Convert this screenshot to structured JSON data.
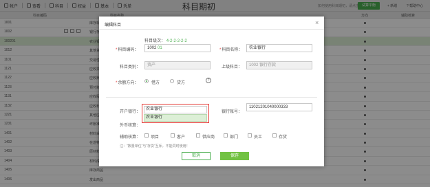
{
  "toolbar": {
    "items": [
      "帐户",
      "查看",
      "科目",
      "权益",
      "基本",
      "凭单"
    ],
    "title": "科目期初",
    "right_text": "如何使用科目期初，请点击查看帮助",
    "green_button": "试算平衡",
    "link_add": "+ 新增",
    "link_help": "? 帮助中心"
  },
  "table": {
    "headers": [
      "科目编码",
      "科目名称",
      "方向",
      "辅助核算"
    ],
    "rows": [
      {
        "code": "1001",
        "name": "库存现金"
      },
      {
        "code": "1002",
        "name": "银行存款"
      },
      {
        "code": "100201",
        "name": "农业银行",
        "selected": true
      },
      {
        "code": "1012",
        "name": "其他货币资金"
      },
      {
        "code": "1101",
        "name": "交易性金融资产"
      },
      {
        "code": "1121",
        "name": "应收票据"
      },
      {
        "code": "1122",
        "name": "应收账款"
      },
      {
        "code": "1123",
        "name": "预付账款"
      },
      {
        "code": "1131",
        "name": "应收股利"
      },
      {
        "code": "1132",
        "name": "应收利息"
      },
      {
        "code": "1221",
        "name": "其他应收款"
      },
      {
        "code": "1231",
        "name": "坏账准备"
      },
      {
        "code": "1401",
        "name": "材料采购"
      },
      {
        "code": "1402",
        "name": "在途物资"
      },
      {
        "code": "1403",
        "name": "原材料"
      },
      {
        "code": "1404",
        "name": "材料成本差异"
      },
      {
        "code": "1405",
        "name": "库存商品"
      },
      {
        "code": "1406",
        "name": "发出商品"
      }
    ]
  },
  "dialog": {
    "title": "编辑科目",
    "code_level_label": "科目级次：",
    "code_level": "4-2-2-2-2-2",
    "code_label": "科目编码：",
    "code_prefix": "1002",
    "code_suffix": "01",
    "name_label": "科目名称：",
    "name_value": "农业银行",
    "category_label": "科目类别：",
    "category_value": "资产",
    "parent_label": "上级科目：",
    "parent_value": "1002 银行存款",
    "direction_label": "余额方向：",
    "direction_debit": "借方",
    "direction_credit": "贷方",
    "help_glyph": "?",
    "bank_label": "开户银行：",
    "bank_value": "农业银行",
    "bank_option": "农业银行",
    "account_label": "银行账号：",
    "account_value": "11021201040000333",
    "currency_label": "外币核算：",
    "aux_label": "辅助核算：",
    "aux_items": [
      "项目",
      "客户",
      "供应商",
      "部门",
      "员工",
      "存货"
    ],
    "note": "注：“数量单位”与“存货”互斥，不能同时使用！",
    "cancel": "取消",
    "save": "保存"
  }
}
